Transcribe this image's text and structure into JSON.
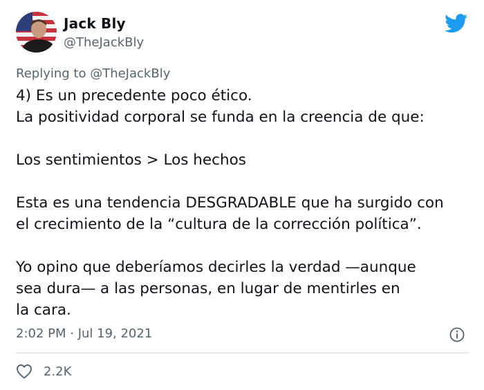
{
  "tweet": {
    "author_name": "Jack Bly",
    "author_handle": "@TheJackBly",
    "replying_prefix": "Replying to ",
    "replying_handle": "@TheJackBly",
    "text": "4) Es un precedente poco ético.\nLa positividad corporal se funda en la creencia de que:\n\nLos sentimientos > Los hechos\n\nEsta es una tendencia DESGRADABLE que ha surgido con\nel crecimiento de la “cultura de la corrección política”.\n\nYo opino que deberíamos decirles la verdad —aunque\nsea dura— a las personas, en lugar de mentirles en\nla cara.",
    "timestamp": "2:02 PM · Jul 19, 2021",
    "like_count": "2.2K"
  },
  "icons": {
    "brand": "twitter-bird-icon",
    "info": "info-icon",
    "like": "heart-icon"
  },
  "colors": {
    "brand_blue": "#1d9bf0",
    "secondary_text": "#536471",
    "primary_text": "#0f1419"
  }
}
